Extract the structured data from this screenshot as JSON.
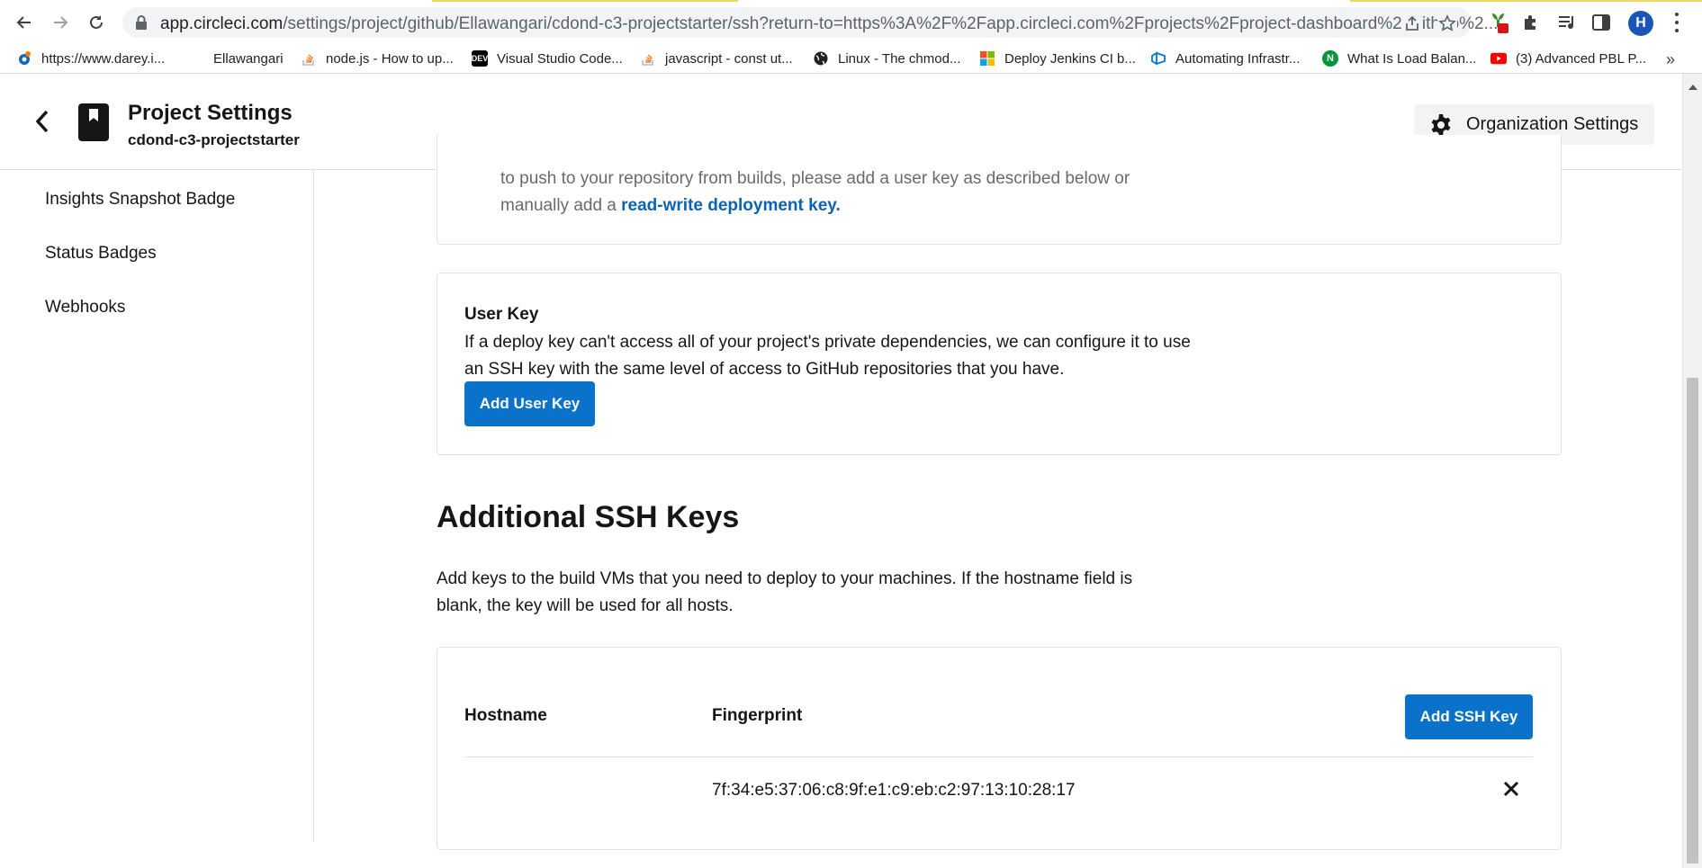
{
  "browser": {
    "url_host": "app.circleci.com",
    "url_path": "/settings/project/github/Ellawangari/cdond-c3-projectstarter/ssh?return-to=https%3A%2F%2Fapp.circleci.com%2Fprojects%2Fproject-dashboard%2Fgithub%2...",
    "profile_initial": "H",
    "bookmarks": [
      {
        "label": "https://www.darey.i...",
        "icon": "darey-icon"
      },
      {
        "label": "Ellawangari",
        "icon": ""
      },
      {
        "label": "node.js - How to up...",
        "icon": "stackoverflow-icon"
      },
      {
        "label": "Visual Studio Code...",
        "icon": "dev-icon"
      },
      {
        "label": "javascript - const ut...",
        "icon": "stackoverflow-icon"
      },
      {
        "label": "Linux - The chmod...",
        "icon": "globe-icon"
      },
      {
        "label": "Deploy Jenkins CI b...",
        "icon": "microsoft-icon"
      },
      {
        "label": "Automating Infrastr...",
        "icon": "azure-icon"
      },
      {
        "label": "What Is Load Balan...",
        "icon": "nginx-icon"
      },
      {
        "label": "(3) Advanced PBL P...",
        "icon": "youtube-icon"
      }
    ],
    "dev_icon_text": "DEV",
    "more_bookmarks": "»"
  },
  "header": {
    "title": "Project Settings",
    "subtitle": "cdond-c3-projectstarter",
    "org_settings_label": "Organization Settings"
  },
  "sidebar": {
    "items": [
      {
        "label": "Insights Snapshot Badge"
      },
      {
        "label": "Status Badges"
      },
      {
        "label": "Webhooks"
      }
    ]
  },
  "deploy_key_card": {
    "text_line1": "to push to your repository from builds, please add a user key as described below or",
    "text_line2_prefix": "manually add a ",
    "link_text": "read-write deployment key",
    "text_line2_suffix": "."
  },
  "user_key": {
    "title": "User Key",
    "description": "If a deploy key can't access all of your project's private dependencies, we can configure it to use an SSH key with the same level of access to GitHub repositories that you have.",
    "button_label": "Add User Key"
  },
  "additional_ssh": {
    "title": "Additional SSH Keys",
    "description": "Add keys to the build VMs that you need to deploy to your machines. If the hostname field is blank, the key will be used for all hosts.",
    "columns": [
      "Hostname",
      "Fingerprint"
    ],
    "add_button_label": "Add SSH Key",
    "rows": [
      {
        "hostname": "",
        "fingerprint": "7f:34:e5:37:06:c8:9f:e1:c9:eb:c2:97:13:10:28:17"
      }
    ]
  },
  "colors": {
    "primary_button": "#0a72c9",
    "link": "#0b63b5",
    "text": "#161616"
  }
}
